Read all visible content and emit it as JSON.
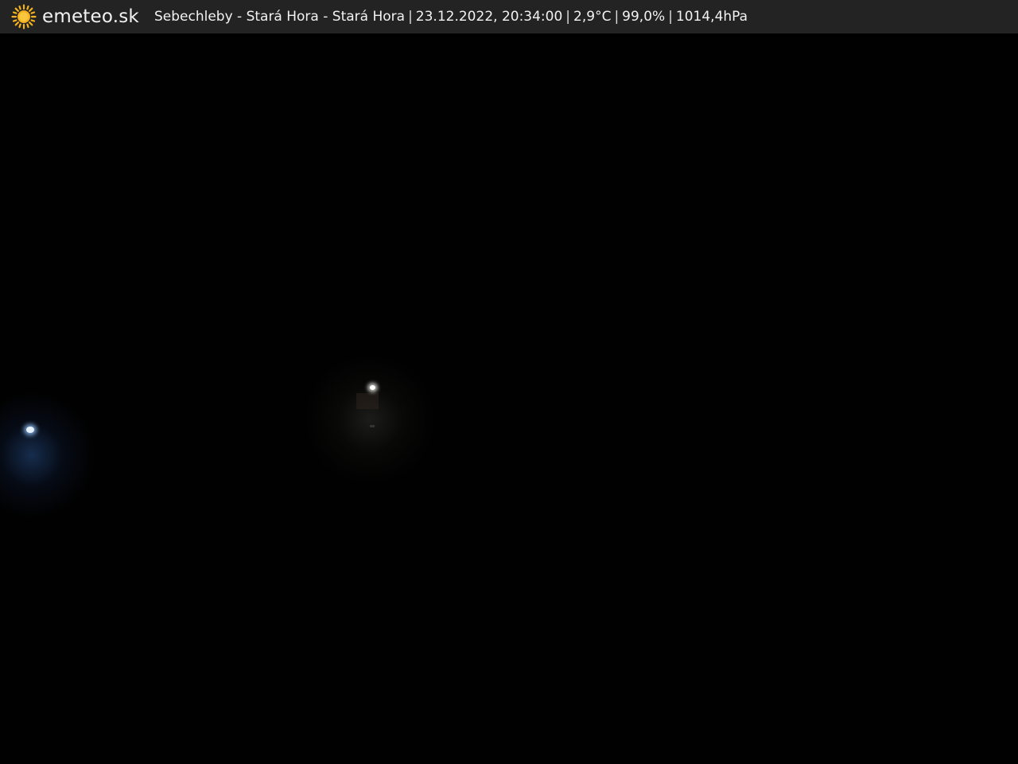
{
  "header": {
    "brand": "emeteo.sk",
    "logo_icon": "sun-icon",
    "location": "Sebechleby - Stará Hora - Stará Hora",
    "datetime": "23.12.2022, 20:34:00",
    "temperature": "2,9°C",
    "humidity": "99,0%",
    "pressure": "1014,4hPa",
    "separator": "|"
  },
  "colors": {
    "bar_background": "#232323",
    "sun": "#f5b21f",
    "scene": "#010101"
  }
}
